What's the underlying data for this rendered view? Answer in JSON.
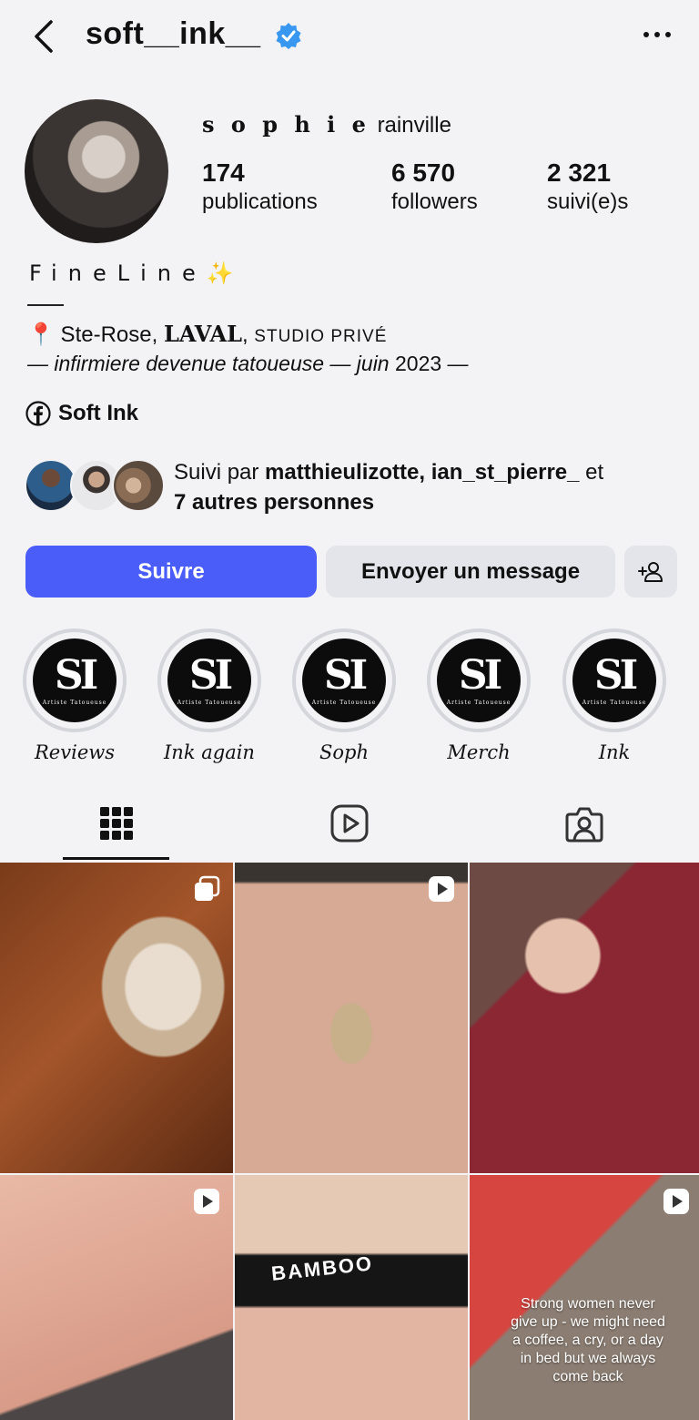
{
  "header": {
    "username": "soft__ink__"
  },
  "profile": {
    "display_name_spaced": "s o p h i e",
    "display_name_rest": "rainville",
    "stats": [
      {
        "value": "174",
        "label": "publications"
      },
      {
        "value": "6 570",
        "label": "followers"
      },
      {
        "value": "2 321",
        "label": "suivi(e)s"
      }
    ]
  },
  "bio": {
    "title": "FineLine",
    "sparkle": "✨",
    "pin": "📍",
    "location_a": " Ste-Rose, ",
    "location_b": "LAVAL",
    "location_c": ", ",
    "location_d": "STUDIO PRIVÉ",
    "tagline": "— infirmiere devenue tatoueuse — juin ",
    "tagline_year": "2023",
    "tagline_end": " —"
  },
  "link": {
    "label": "Soft Ink"
  },
  "followed_by": {
    "prefix": "Suivi par ",
    "names": "matthieulizotte, ian_st_pierre_",
    "connector": " et",
    "others": "7 autres personnes"
  },
  "actions": {
    "follow": "Suivre",
    "message": "Envoyer un message"
  },
  "highlights": [
    {
      "name": "Reviews"
    },
    {
      "name": "Ink again"
    },
    {
      "name": "Soph"
    },
    {
      "name": "Merch"
    },
    {
      "name": "Ink"
    }
  ],
  "highlight_logo": {
    "mono": "SI",
    "sub": "Artiste Tatoueuse"
  },
  "posts": [
    {
      "kind": "carousel"
    },
    {
      "kind": "reel"
    },
    {
      "kind": "image"
    },
    {
      "kind": "reel"
    },
    {
      "kind": "image",
      "overlay_text": "BAMBOO"
    },
    {
      "kind": "reel",
      "overlay_text": "Strong women never give up - we might need a coffee, a cry, or a day in bed but we always come back"
    }
  ],
  "colors": {
    "follow_button": "#4a5df9",
    "verified": "#3897f0",
    "background": "#f3f3f5"
  }
}
